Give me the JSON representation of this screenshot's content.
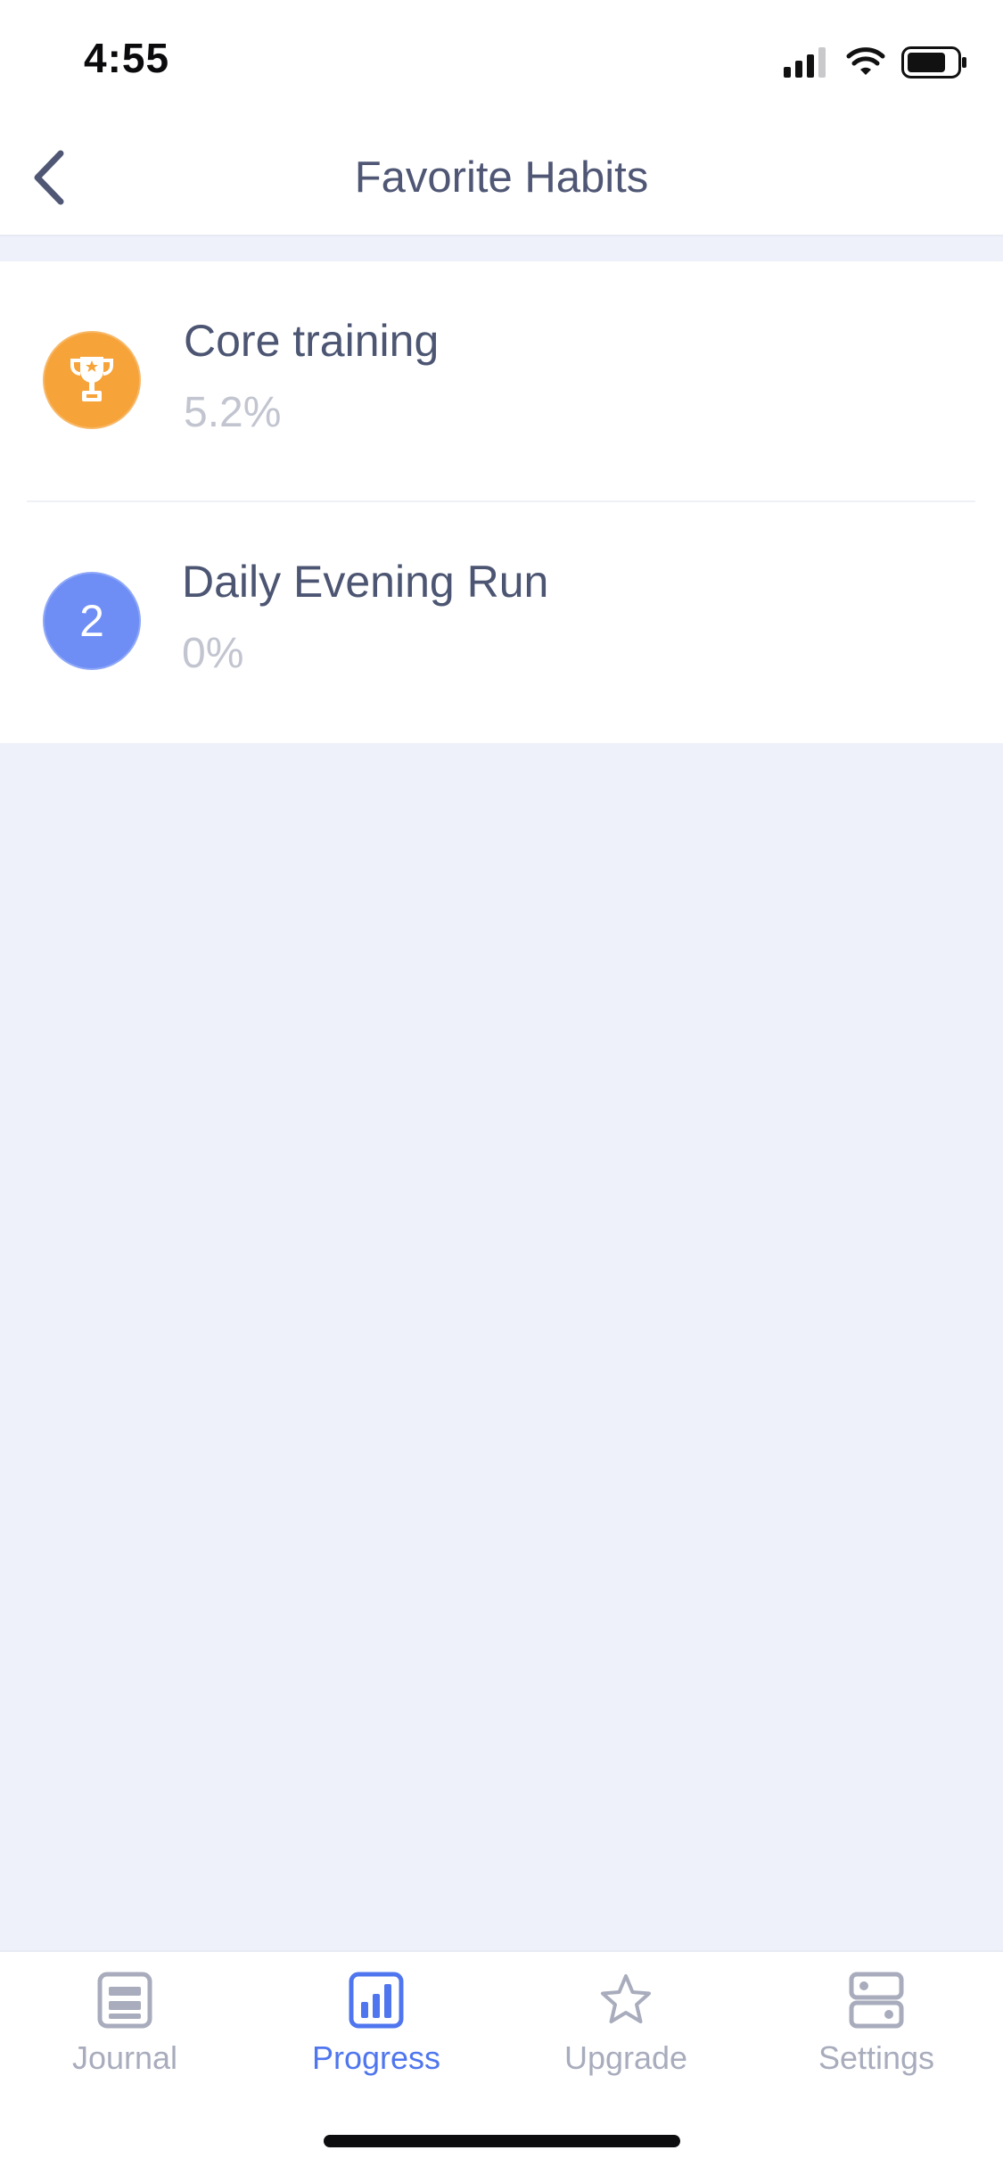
{
  "status": {
    "time": "4:55"
  },
  "header": {
    "title": "Favorite Habits"
  },
  "habits": [
    {
      "name": "Core training",
      "percent": "5.2%",
      "badge": "trophy",
      "badge_color": "#f6a33a"
    },
    {
      "name": "Daily Evening Run",
      "percent": "0%",
      "badge_label": "2",
      "badge_color": "#6e8ef6"
    }
  ],
  "tabs": [
    {
      "label": "Journal",
      "icon": "journal-icon",
      "active": false
    },
    {
      "label": "Progress",
      "icon": "bar-chart-icon",
      "active": true
    },
    {
      "label": "Upgrade",
      "icon": "star-icon",
      "active": false
    },
    {
      "label": "Settings",
      "icon": "settings-icon",
      "active": false
    }
  ],
  "colors": {
    "accent": "#4f76ee",
    "inactive": "#a8acbc",
    "background": "#eef1f9"
  }
}
